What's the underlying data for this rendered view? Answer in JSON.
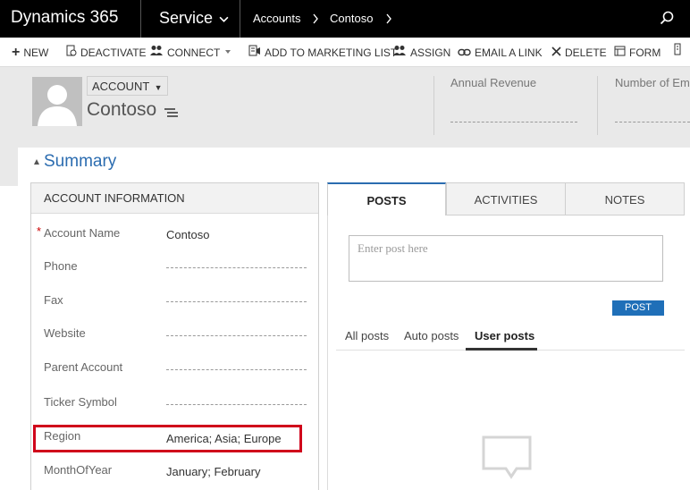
{
  "topnav": {
    "brand": "Dynamics 365",
    "module": "Service",
    "breadcrumbs": [
      "Accounts",
      "Contoso"
    ],
    "search_icon": "search-icon"
  },
  "commands": [
    {
      "label": "NEW",
      "icon": "plus-icon"
    },
    {
      "label": "DEACTIVATE",
      "icon": "deactivate-icon"
    },
    {
      "label": "CONNECT",
      "icon": "connect-icon"
    },
    {
      "label": "ADD TO MARKETING LIST",
      "icon": "marketing-list-icon"
    },
    {
      "label": "ASSIGN",
      "icon": "assign-icon"
    },
    {
      "label": "EMAIL A LINK",
      "icon": "link-icon"
    },
    {
      "label": "DELETE",
      "icon": "close-icon"
    },
    {
      "label": "FORM",
      "icon": "form-icon"
    }
  ],
  "header": {
    "entity_type": "ACCOUNT",
    "record_name": "Contoso",
    "fields": [
      "Annual Revenue",
      "Number of Emp"
    ]
  },
  "summary": {
    "title": "Summary"
  },
  "account_info": {
    "title": "ACCOUNT INFORMATION",
    "fields": [
      {
        "label": "Account Name",
        "value": "Contoso",
        "required": "*"
      },
      {
        "label": "Phone",
        "value": ""
      },
      {
        "label": "Fax",
        "value": ""
      },
      {
        "label": "Website",
        "value": ""
      },
      {
        "label": "Parent Account",
        "value": ""
      },
      {
        "label": "Ticker Symbol",
        "value": ""
      },
      {
        "label": "Region",
        "value": "America; Asia; Europe"
      },
      {
        "label": "MonthOfYear",
        "value": "January; February"
      }
    ]
  },
  "social": {
    "tabs": [
      "POSTS",
      "ACTIVITIES",
      "NOTES"
    ],
    "post_placeholder": "Enter post here",
    "post_button": "POST",
    "subtabs": [
      "All posts",
      "Auto posts",
      "User posts"
    ]
  },
  "colors": {
    "accent": "#2b6cb0",
    "highlight": "#d0021b",
    "nav_bg": "#000000"
  }
}
